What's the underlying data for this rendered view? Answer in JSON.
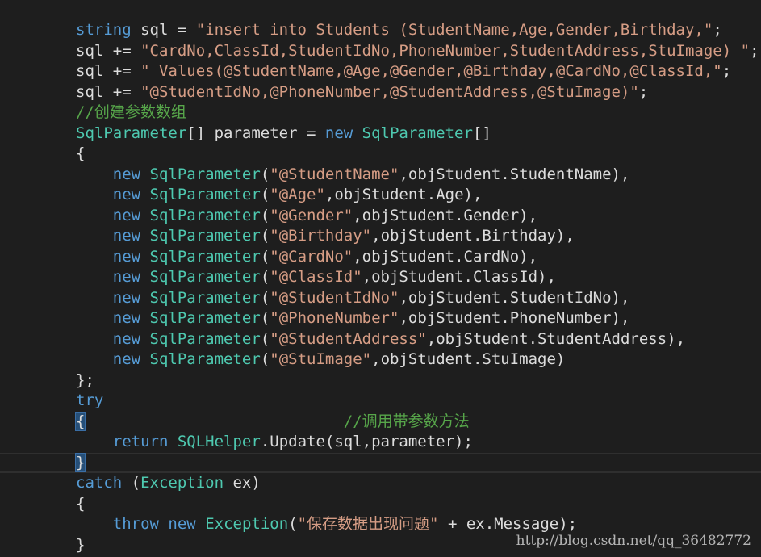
{
  "editor": {
    "lines": [
      {
        "tokens": [
          {
            "t": "string",
            "c": "keyword"
          },
          {
            "t": " sql = ",
            "c": "plain"
          },
          {
            "t": "\"insert into Students (StudentName,Age,Gender,Birthday,\"",
            "c": "string"
          },
          {
            "t": ";",
            "c": "plain"
          }
        ]
      },
      {
        "tokens": [
          {
            "t": "sql += ",
            "c": "plain"
          },
          {
            "t": "\"CardNo,ClassId,StudentIdNo,PhoneNumber,StudentAddress,StuImage) \"",
            "c": "string"
          },
          {
            "t": ";",
            "c": "plain"
          }
        ]
      },
      {
        "tokens": [
          {
            "t": "sql += ",
            "c": "plain"
          },
          {
            "t": "\" Values(@StudentName,@Age,@Gender,@Birthday,@CardNo,@ClassId,\"",
            "c": "string"
          },
          {
            "t": ";",
            "c": "plain"
          }
        ]
      },
      {
        "tokens": [
          {
            "t": "sql += ",
            "c": "plain"
          },
          {
            "t": "\"@StudentIdNo,@PhoneNumber,@StudentAddress,@StuImage)\"",
            "c": "string"
          },
          {
            "t": ";",
            "c": "plain"
          }
        ]
      },
      {
        "tokens": [
          {
            "t": "//创建参数数组",
            "c": "comment"
          }
        ]
      },
      {
        "tokens": [
          {
            "t": "SqlParameter",
            "c": "type"
          },
          {
            "t": "[] parameter = ",
            "c": "plain"
          },
          {
            "t": "new",
            "c": "keyword"
          },
          {
            "t": " ",
            "c": "plain"
          },
          {
            "t": "SqlParameter",
            "c": "type"
          },
          {
            "t": "[]",
            "c": "plain"
          }
        ]
      },
      {
        "tokens": [
          {
            "t": "{",
            "c": "plain"
          }
        ]
      },
      {
        "tokens": [
          {
            "t": "    ",
            "c": "plain"
          },
          {
            "t": "new",
            "c": "keyword"
          },
          {
            "t": " ",
            "c": "plain"
          },
          {
            "t": "SqlParameter",
            "c": "type"
          },
          {
            "t": "(",
            "c": "plain"
          },
          {
            "t": "\"@StudentName\"",
            "c": "string"
          },
          {
            "t": ",objStudent.StudentName),",
            "c": "plain"
          }
        ]
      },
      {
        "tokens": [
          {
            "t": "    ",
            "c": "plain"
          },
          {
            "t": "new",
            "c": "keyword"
          },
          {
            "t": " ",
            "c": "plain"
          },
          {
            "t": "SqlParameter",
            "c": "type"
          },
          {
            "t": "(",
            "c": "plain"
          },
          {
            "t": "\"@Age\"",
            "c": "string"
          },
          {
            "t": ",objStudent.Age),",
            "c": "plain"
          }
        ]
      },
      {
        "tokens": [
          {
            "t": "    ",
            "c": "plain"
          },
          {
            "t": "new",
            "c": "keyword"
          },
          {
            "t": " ",
            "c": "plain"
          },
          {
            "t": "SqlParameter",
            "c": "type"
          },
          {
            "t": "(",
            "c": "plain"
          },
          {
            "t": "\"@Gender\"",
            "c": "string"
          },
          {
            "t": ",objStudent.Gender),",
            "c": "plain"
          }
        ]
      },
      {
        "tokens": [
          {
            "t": "    ",
            "c": "plain"
          },
          {
            "t": "new",
            "c": "keyword"
          },
          {
            "t": " ",
            "c": "plain"
          },
          {
            "t": "SqlParameter",
            "c": "type"
          },
          {
            "t": "(",
            "c": "plain"
          },
          {
            "t": "\"@Birthday\"",
            "c": "string"
          },
          {
            "t": ",objStudent.Birthday),",
            "c": "plain"
          }
        ]
      },
      {
        "tokens": [
          {
            "t": "    ",
            "c": "plain"
          },
          {
            "t": "new",
            "c": "keyword"
          },
          {
            "t": " ",
            "c": "plain"
          },
          {
            "t": "SqlParameter",
            "c": "type"
          },
          {
            "t": "(",
            "c": "plain"
          },
          {
            "t": "\"@CardNo\"",
            "c": "string"
          },
          {
            "t": ",objStudent.CardNo),",
            "c": "plain"
          }
        ]
      },
      {
        "tokens": [
          {
            "t": "    ",
            "c": "plain"
          },
          {
            "t": "new",
            "c": "keyword"
          },
          {
            "t": " ",
            "c": "plain"
          },
          {
            "t": "SqlParameter",
            "c": "type"
          },
          {
            "t": "(",
            "c": "plain"
          },
          {
            "t": "\"@ClassId\"",
            "c": "string"
          },
          {
            "t": ",objStudent.ClassId),",
            "c": "plain"
          }
        ]
      },
      {
        "tokens": [
          {
            "t": "    ",
            "c": "plain"
          },
          {
            "t": "new",
            "c": "keyword"
          },
          {
            "t": " ",
            "c": "plain"
          },
          {
            "t": "SqlParameter",
            "c": "type"
          },
          {
            "t": "(",
            "c": "plain"
          },
          {
            "t": "\"@StudentIdNo\"",
            "c": "string"
          },
          {
            "t": ",objStudent.StudentIdNo),",
            "c": "plain"
          }
        ]
      },
      {
        "tokens": [
          {
            "t": "    ",
            "c": "plain"
          },
          {
            "t": "new",
            "c": "keyword"
          },
          {
            "t": " ",
            "c": "plain"
          },
          {
            "t": "SqlParameter",
            "c": "type"
          },
          {
            "t": "(",
            "c": "plain"
          },
          {
            "t": "\"@PhoneNumber\"",
            "c": "string"
          },
          {
            "t": ",objStudent.PhoneNumber),",
            "c": "plain"
          }
        ]
      },
      {
        "tokens": [
          {
            "t": "    ",
            "c": "plain"
          },
          {
            "t": "new",
            "c": "keyword"
          },
          {
            "t": " ",
            "c": "plain"
          },
          {
            "t": "SqlParameter",
            "c": "type"
          },
          {
            "t": "(",
            "c": "plain"
          },
          {
            "t": "\"@StudentAddress\"",
            "c": "string"
          },
          {
            "t": ",objStudent.StudentAddress),",
            "c": "plain"
          }
        ]
      },
      {
        "tokens": [
          {
            "t": "    ",
            "c": "plain"
          },
          {
            "t": "new",
            "c": "keyword"
          },
          {
            "t": " ",
            "c": "plain"
          },
          {
            "t": "SqlParameter",
            "c": "type"
          },
          {
            "t": "(",
            "c": "plain"
          },
          {
            "t": "\"@StuImage\"",
            "c": "string"
          },
          {
            "t": ",objStudent.StuImage)",
            "c": "plain"
          }
        ]
      },
      {
        "tokens": [
          {
            "t": "};",
            "c": "plain"
          }
        ]
      },
      {
        "tokens": [
          {
            "t": "try",
            "c": "keyword"
          }
        ]
      },
      {
        "tokens": [
          {
            "t": "{",
            "c": "plain",
            "hl": true
          },
          {
            "t": "                            ",
            "c": "plain"
          },
          {
            "t": "//调用带参数方法",
            "c": "comment"
          }
        ]
      },
      {
        "tokens": [
          {
            "t": "    ",
            "c": "plain"
          },
          {
            "t": "return",
            "c": "keyword"
          },
          {
            "t": " ",
            "c": "plain"
          },
          {
            "t": "SQLHelper",
            "c": "type"
          },
          {
            "t": ".Update(sql,parameter);",
            "c": "plain"
          }
        ]
      },
      {
        "tokens": [
          {
            "t": "}",
            "c": "plain",
            "hl": true
          }
        ],
        "current": true
      },
      {
        "tokens": [
          {
            "t": "catch",
            "c": "keyword"
          },
          {
            "t": " (",
            "c": "plain"
          },
          {
            "t": "Exception",
            "c": "type"
          },
          {
            "t": " ex)",
            "c": "plain"
          }
        ]
      },
      {
        "tokens": [
          {
            "t": "{",
            "c": "plain"
          }
        ]
      },
      {
        "tokens": [
          {
            "t": "    ",
            "c": "plain"
          },
          {
            "t": "throw",
            "c": "keyword"
          },
          {
            "t": " ",
            "c": "plain"
          },
          {
            "t": "new",
            "c": "keyword"
          },
          {
            "t": " ",
            "c": "plain"
          },
          {
            "t": "Exception",
            "c": "type"
          },
          {
            "t": "(",
            "c": "plain"
          },
          {
            "t": "\"保存数据出现问题\"",
            "c": "string"
          },
          {
            "t": " + ex.Message);",
            "c": "plain"
          }
        ]
      },
      {
        "tokens": [
          {
            "t": "}",
            "c": "plain"
          }
        ]
      }
    ]
  },
  "watermark": {
    "text": "http://blog.csdn.net/qq_36482772"
  },
  "colors": {
    "background": "#1e1e1e",
    "keyword": "#569cd6",
    "type": "#4ec9b0",
    "string": "#d69d85",
    "comment": "#57a64a",
    "plain": "#dcdcdc"
  }
}
